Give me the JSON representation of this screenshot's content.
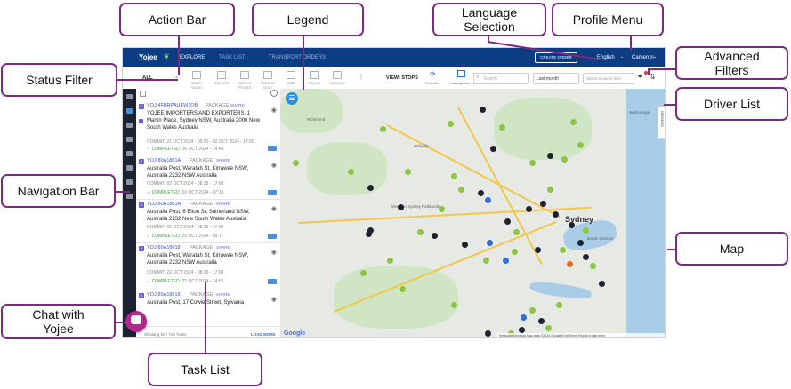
{
  "callouts": {
    "action_bar": "Action Bar",
    "legend": "Legend",
    "language_selection": "Language\nSelection",
    "profile_menu": "Profile Menu",
    "status_filter": "Status Filter",
    "advanced_filters": "Advanced\nFilters",
    "driver_list": "Driver List",
    "navigation_bar": "Navigation Bar",
    "map": "Map",
    "chat": "Chat with\nYojee",
    "task_list": "Task List"
  },
  "app": {
    "logo": "Yojee",
    "tabs": [
      "EXPLORE",
      "TASK LIST",
      "TRANSPORT ORDERS"
    ],
    "create_order": "CREATE ORDER",
    "language": "English",
    "profile": "Cameron",
    "toolbar": {
      "status": "ALL",
      "actions": [
        "Batch Assign",
        "Optimize",
        "Mark as Picked",
        "Mark as Drop",
        "Edit",
        "Report",
        "Unassign"
      ],
      "view_label": "VIEW: STOPS",
      "refresh": "Refresh",
      "heatmap": "Unassignable",
      "search_placeholder": "Search",
      "date_range": "Last month",
      "saved_filter": "Select a saved filter"
    },
    "tasks": [
      {
        "id": "YOJ-4FBRPAUEW1QB",
        "type": "PACKAGE",
        "tag": "SHARE",
        "address": "YOJEE IMPORTERS AND EXPORTERS, 1 Martin Place, Sydney NSW, Australia 2000 New South Wales Australia",
        "commit": "COMMIT: 21 OCT 2024 - 09:00 - 02 OCT 2024 - 17:00",
        "status": "COMPLETED",
        "status_date": "06 OCT 2024 - 14:48"
      },
      {
        "id": "YOJ-80A1861A",
        "type": "PACKAGE",
        "tag": "SHARE",
        "address": "Australia Post, Waratah St, Kirrawee NSW, Australia 2232 NSW Australia",
        "commit": "COMMIT: 02 OCT 2024 - 08:29 - 17:00",
        "status": "COMPLETED",
        "status_date": "10 OCT 2024 - 07:38"
      },
      {
        "id": "YOJ-80A1861A",
        "type": "PACKAGE",
        "tag": "SHARE",
        "address": "Australia Post, 6 Elton St, Sutherland NSW, Australia 2232 New South Wales Australia",
        "commit": "COMMIT: 02 OCT 2024 - 08:29 - 17:00",
        "status": "COMPLETED",
        "status_date": "25 OCT 2024 - 09:17"
      },
      {
        "id": "YOJ-80A18618",
        "type": "PACKAGE",
        "tag": "SHARE",
        "address": "Australia Post, Waratah St, Kirrawee NSW, Australia 2232 NSW Australia",
        "commit": "COMMIT: 22 OCT 2024 - 08:29 - 17:00",
        "status": "COMPLETED",
        "status_date": "22 OCT 2024 - 14:55"
      },
      {
        "id": "YOJ-80A18618",
        "type": "PACKAGE",
        "tag": "SHARE",
        "address": "Australia Post, 17 Cowie Street, Sylvania",
        "commit": "",
        "status": "",
        "status_date": ""
      }
    ],
    "footer_count": "Showing 50 / 740 Tasks",
    "load_more": "LOAD MORE",
    "drivers_tab": "DRIVERS",
    "map_labels": [
      "Sydney",
      "Western Sydney Parklands",
      "Bondi Junction",
      "Kellyville",
      "Richmond",
      "Wahroonga"
    ],
    "map_footer": "Keyboard shortcuts  Map data ©2024 Google  5 km  Terms  Report a map error",
    "google": "Google"
  },
  "colors": {
    "accent": "#7b2a7f",
    "topbar": "#0c3c82",
    "completed": "#3a9b3a",
    "pin_green": "#8cc63f",
    "pin_dark": "#1e2230",
    "chat": "#b3268c"
  }
}
